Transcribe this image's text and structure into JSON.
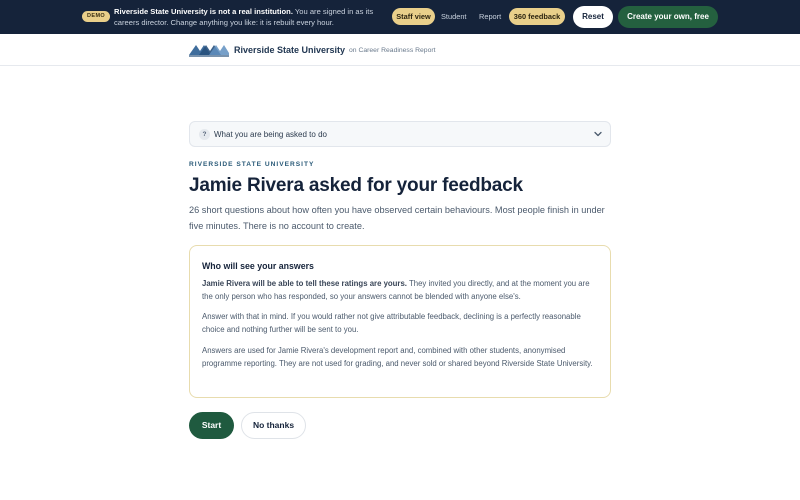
{
  "demo_bar": {
    "badge": "DEMO",
    "notice_bold": "Riverside State University is not a real institution.",
    "notice_rest": " You are signed in as its careers director. Change anything you like: it is rebuilt every hour.",
    "staff_view": "Staff view",
    "student": "Student",
    "report": "Report",
    "feedback_360": "360 feedback",
    "reset": "Reset",
    "create": "Create your own, free"
  },
  "header": {
    "university": "Riverside State University",
    "context": "on Career Readiness Report"
  },
  "accordion": {
    "icon": "?",
    "label": "What you are being asked to do",
    "expanded": false
  },
  "main": {
    "eyebrow": "RIVERSIDE STATE UNIVERSITY",
    "title": "Jamie Rivera asked for your feedback",
    "intro": "26 short questions about how often you have observed certain behaviours. Most people finish in under five minutes. There is no account to create."
  },
  "card": {
    "title": "Who will see your answers",
    "p1_bold": "Jamie Rivera will be able to tell these ratings are yours.",
    "p1_rest": " They invited you directly, and at the moment you are the only person who has responded, so your answers cannot be blended with anyone else's.",
    "p2": "Answer with that in mind. If you would rather not give attributable feedback, declining is a perfectly reasonable choice and nothing further will be sent to you.",
    "p3": "Answers are used for Jamie Rivera's development report and, combined with other students, anonymised programme reporting. They are not used for grading, and never sold or shared beyond Riverside State University."
  },
  "actions": {
    "start": "Start",
    "decline": "No thanks"
  },
  "colors": {
    "banner_bg": "#15233a",
    "accent_gold": "#e9cf8a",
    "primary_green": "#1f5a3f",
    "card_border": "#e8dcae"
  }
}
